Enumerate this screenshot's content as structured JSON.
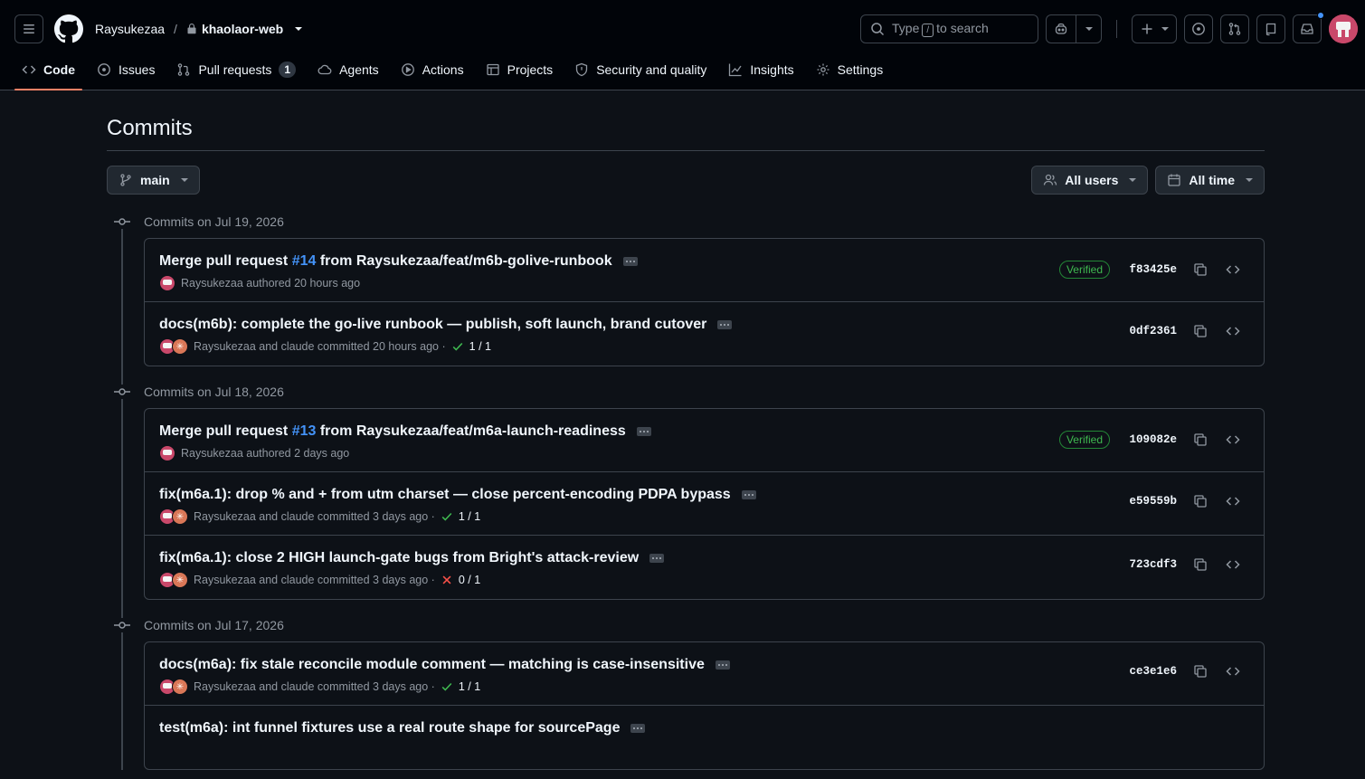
{
  "header": {
    "owner": "Raysukezaa",
    "separator": "/",
    "repo": "khaolaor-web",
    "search_pre": "Type",
    "search_key": "/",
    "search_post": "to search"
  },
  "tabs": [
    {
      "label": "Code",
      "icon": "code-icon",
      "active": true
    },
    {
      "label": "Issues",
      "icon": "issue-icon"
    },
    {
      "label": "Pull requests",
      "icon": "pull-request-icon",
      "count": "1"
    },
    {
      "label": "Agents",
      "icon": "agent-cloud-icon"
    },
    {
      "label": "Actions",
      "icon": "play-icon"
    },
    {
      "label": "Projects",
      "icon": "table-icon"
    },
    {
      "label": "Security and quality",
      "icon": "shield-icon"
    },
    {
      "label": "Insights",
      "icon": "graph-icon"
    },
    {
      "label": "Settings",
      "icon": "gear-icon"
    }
  ],
  "page": {
    "title": "Commits",
    "branch": "main",
    "users_filter": "All users",
    "time_filter": "All time"
  },
  "colors": {
    "background": "#0d1117",
    "header": "#010409",
    "border": "#3d444d",
    "accent_link": "#4493f8",
    "success": "#3fb950",
    "danger": "#f85149",
    "active_tab": "#f78166"
  },
  "groups": [
    {
      "heading": "Commits on Jul 19, 2026",
      "commits": [
        {
          "pre": "Merge pull request ",
          "pr": "#14",
          "post": " from Raysukezaa/feat/m6b-golive-runbook",
          "author": "Raysukezaa authored 20 hours ago",
          "verified": "Verified",
          "sha": "f83425e"
        },
        {
          "title": "docs(m6b): complete the go-live runbook — publish, soft launch, brand cutover",
          "author": "Raysukezaa and claude committed 20 hours ago ·",
          "status": "pass",
          "checks": "1 / 1",
          "sha": "0df2361"
        }
      ]
    },
    {
      "heading": "Commits on Jul 18, 2026",
      "commits": [
        {
          "pre": "Merge pull request ",
          "pr": "#13",
          "post": " from Raysukezaa/feat/m6a-launch-readiness",
          "author": "Raysukezaa authored 2 days ago",
          "verified": "Verified",
          "sha": "109082e"
        },
        {
          "title": "fix(m6a.1): drop % and + from utm charset — close percent-encoding PDPA bypass",
          "author": "Raysukezaa and claude committed 3 days ago ·",
          "status": "pass",
          "checks": "1 / 1",
          "sha": "e59559b"
        },
        {
          "title": "fix(m6a.1): close 2 HIGH launch-gate bugs from Bright's attack-review",
          "author": "Raysukezaa and claude committed 3 days ago ·",
          "status": "fail",
          "checks": "0 / 1",
          "sha": "723cdf3"
        }
      ]
    },
    {
      "heading": "Commits on Jul 17, 2026",
      "commits": [
        {
          "title": "docs(m6a): fix stale reconcile module comment — matching is case-insensitive",
          "author": "Raysukezaa and claude committed 3 days ago ·",
          "status": "pass",
          "checks": "1 / 1",
          "sha": "ce3e1e6"
        },
        {
          "title": "test(m6a): int funnel fixtures use a real route shape for sourcePage",
          "author": "",
          "status": "",
          "checks": "",
          "sha": ""
        }
      ]
    }
  ]
}
